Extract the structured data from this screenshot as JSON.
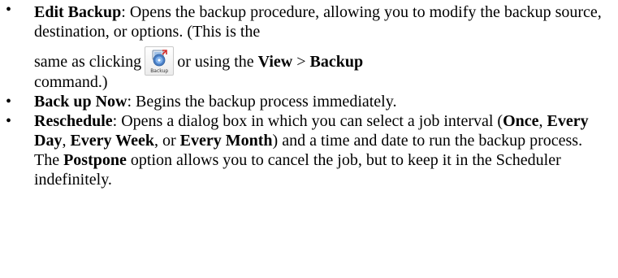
{
  "items": [
    {
      "term": "Edit Backup",
      "text1": ": Opens the backup procedure, allowing you to modify the backup source, destination, or options. (This is the",
      "text2": "same as clicking",
      "icon": "backup-icon",
      "icon_label": "Backup",
      "text3": "or using the",
      "menu": "View",
      "sep": " > ",
      "command": "Backup",
      "text4": "command.)"
    },
    {
      "term": "Back up Now",
      "text1": ": Begins the backup process immediately."
    },
    {
      "term": "Reschedule",
      "text1": ": Opens a dialog box in which you can select a job interval (",
      "opt1": "Once",
      "c1": ", ",
      "opt2": "Every Day",
      "c2": ", ",
      "opt3": "Every Week",
      "c3": ", or ",
      "opt4": "Every Month",
      "text2": ") and a time and date to run the backup process. The ",
      "postpone": "Postpone",
      "text3": " option allows you to cancel the job, but to keep it in the Scheduler indefinitely."
    }
  ],
  "bullet": "•"
}
